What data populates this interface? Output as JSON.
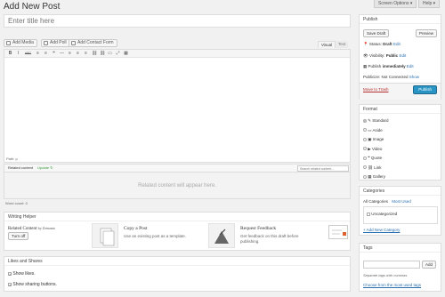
{
  "header": {
    "title": "Add New Post",
    "screen_options": "Screen Options ▾",
    "help": "Help ▾"
  },
  "post": {
    "title_placeholder": "Enter title here"
  },
  "media_buttons": {
    "add_media": "Add Media",
    "add_poll": "Add Poll",
    "add_contact_form": "Add Contact Form"
  },
  "editor": {
    "tab_visual": "Visual",
    "tab_text": "Text",
    "toolbar": [
      "B",
      "I",
      "ABC",
      "≡",
      "≡",
      "❝",
      "—",
      "≡",
      "≡",
      "≡",
      "⛓",
      "⛓",
      "▭",
      "⤢",
      "▦"
    ],
    "path": "Path: p",
    "word_count": "Word count: 0"
  },
  "related": {
    "label": "Related content",
    "update": "Update",
    "search_placeholder": "Search related content...",
    "empty": "Related content will appear here."
  },
  "writing_helper": {
    "title": "Writing Helper",
    "related_title": "Related Content",
    "related_by": "by Zemanta",
    "turn_off": "Turn off",
    "copy_title": "Copy a Post",
    "copy_desc": "Use an existing post as a template.",
    "feedback_title": "Request Feedback",
    "feedback_desc1": "Get feedback on this draft before",
    "feedback_desc2": "publishing."
  },
  "likes": {
    "title": "Likes and Shares",
    "show_likes": "Show likes.",
    "show_sharing": "Show sharing buttons."
  },
  "publish": {
    "title": "Publish",
    "save_draft": "Save Draft",
    "preview": "Preview",
    "status_label": "Status:",
    "status_value": "Draft",
    "visibility_label": "Visibility:",
    "visibility_value": "Public",
    "publish_label": "Publish",
    "publish_value": "immediately",
    "edit": "Edit",
    "publicize": "Publicize: Not Connected",
    "show": "Show",
    "trash": "Move to Trash",
    "publish_button": "Publish"
  },
  "format": {
    "title": "Format",
    "options": [
      "Standard",
      "Aside",
      "Image",
      "Video",
      "Quote",
      "Link",
      "Gallery"
    ]
  },
  "categories": {
    "title": "Categories",
    "tab_all": "All Categories",
    "tab_used": "Most Used",
    "items": [
      "Uncategorized"
    ],
    "add_new": "+ Add New Category"
  },
  "tags": {
    "title": "Tags",
    "add": "Add",
    "hint": "Separate tags with commas",
    "choose": "Choose from the most used tags"
  },
  "colors": {
    "accent": "#2a95c5",
    "link": "#2a6fb0",
    "trash": "#b32d2e"
  }
}
